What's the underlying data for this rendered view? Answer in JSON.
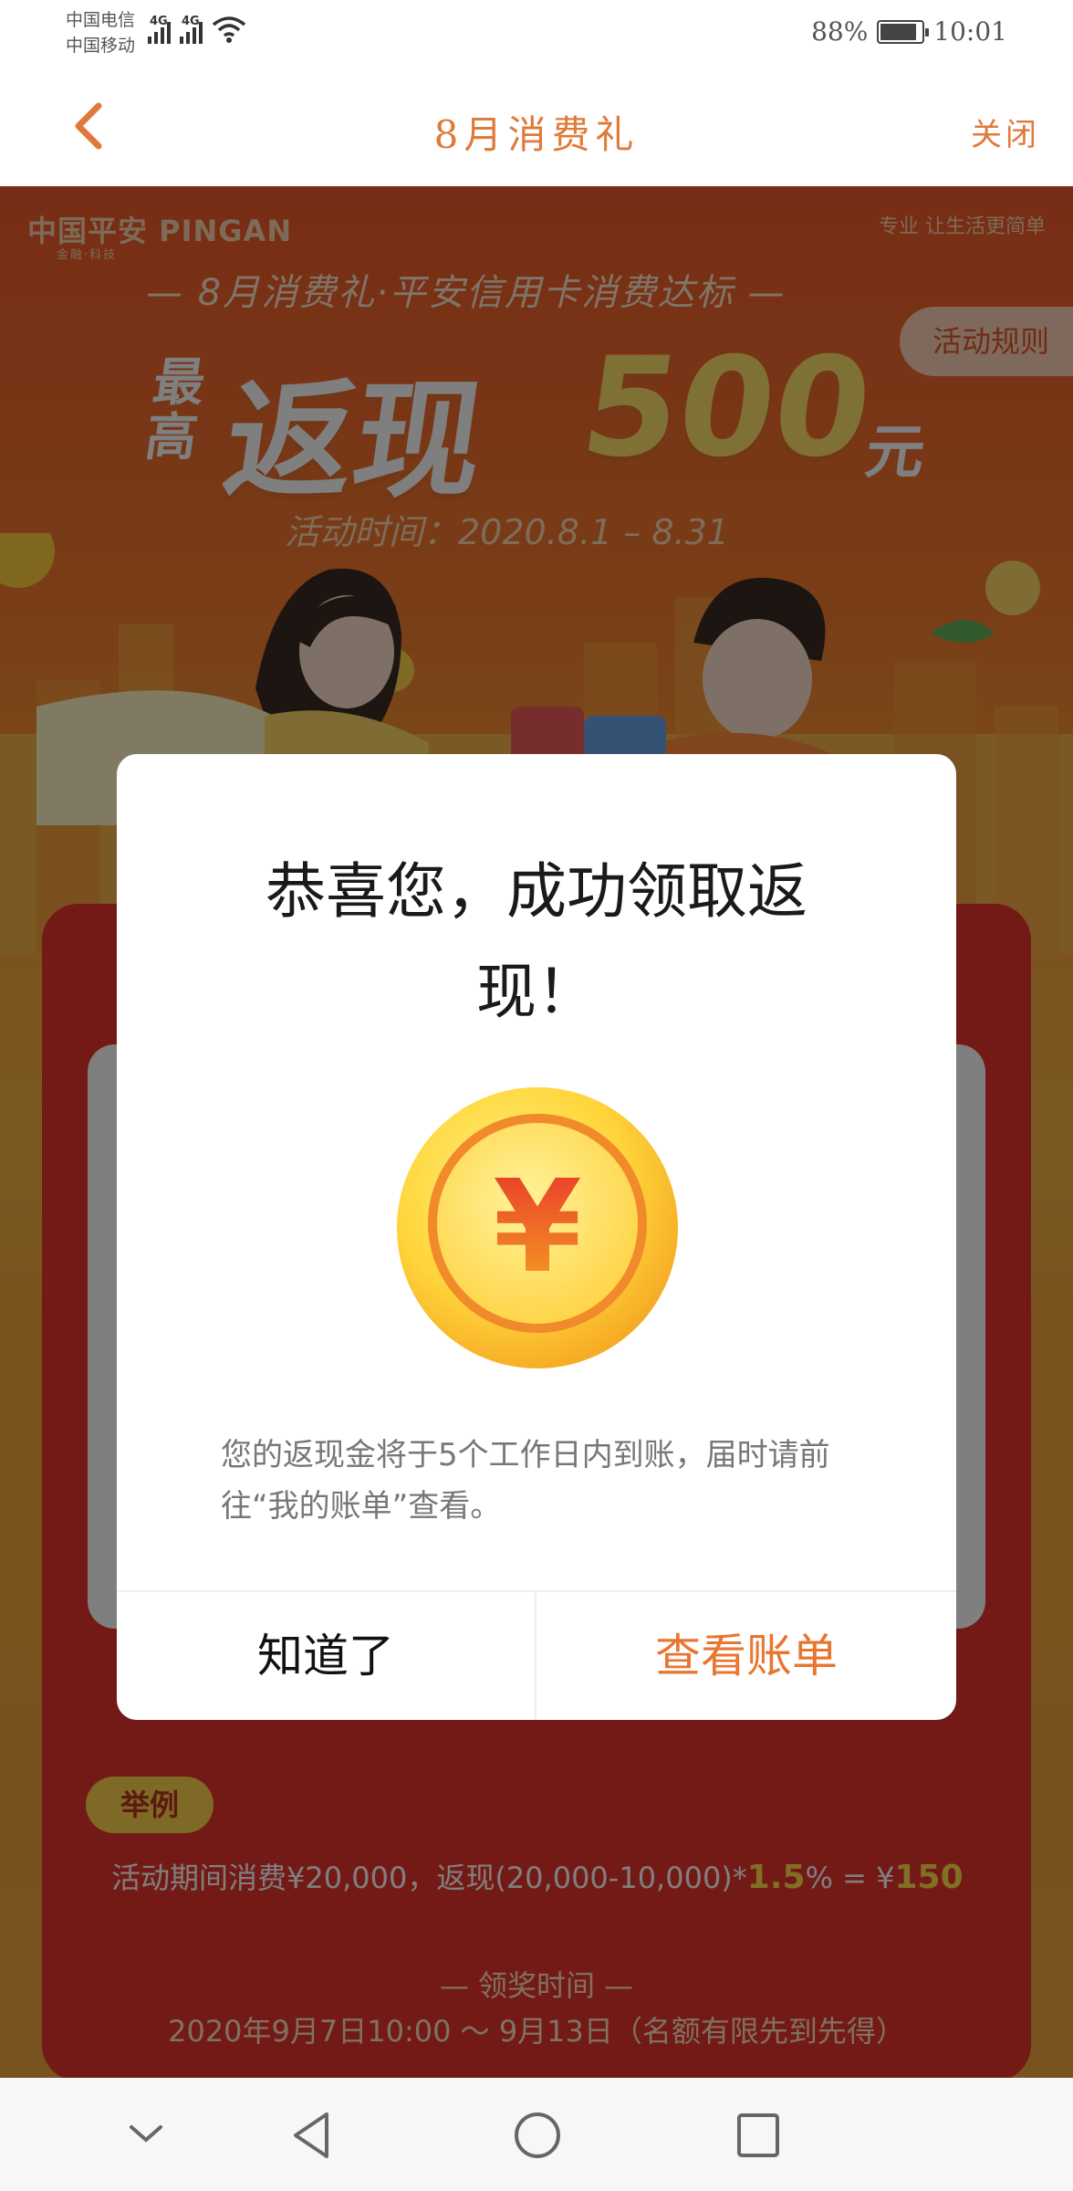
{
  "status_bar": {
    "carrier_1": "中国电信",
    "carrier_2": "中国移动",
    "network_1": "4G",
    "network_2": "4G",
    "battery": "88%",
    "time": "10:01"
  },
  "nav": {
    "title": "8月消费礼",
    "close_label": "关闭"
  },
  "banner": {
    "brand": "中国平安 PINGAN",
    "brand_sub": "金融·科技",
    "slogan": "专业 让生活更简单",
    "subtitle": "— 8月消费礼·平安信用卡消费达标 —",
    "rules_label": "活动规则",
    "headline_small": "最高",
    "headline_big": "返现",
    "headline_amount": "500",
    "headline_unit": "元",
    "time": "活动时间：2020.8.1 – 8.31"
  },
  "example": {
    "tag": "举例",
    "text_prefix": "活动期间消费¥20,000，返现(20,000-10,000)*",
    "rate": "1.5",
    "text_mid": "% = ¥",
    "result": "150"
  },
  "prize": {
    "title": "— 领奖时间 —",
    "time": "2020年9月7日10:00 ～ 9月13日（名额有限先到先得）"
  },
  "modal": {
    "title": "恭喜您，成功领取返现！",
    "coin_symbol": "¥",
    "description": "您的返现金将于5个工作日内到账，届时请前往“我的账单”查看。",
    "ok_label": "知道了",
    "bill_label": "查看账单"
  },
  "colors": {
    "accent": "#e8762f",
    "card_red": "#e8352c",
    "highlight": "#ffe04a"
  }
}
